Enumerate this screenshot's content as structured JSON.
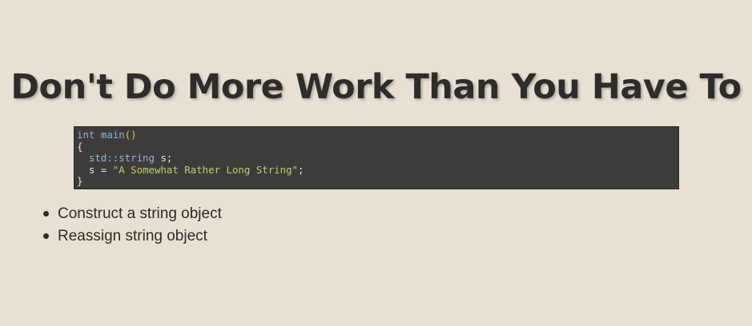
{
  "slide": {
    "title": "Don't Do More Work Than You Have To",
    "code": {
      "line1": {
        "kw": "int",
        "fn": "main",
        "paren": "()"
      },
      "line2": "{",
      "line3": {
        "indent": "  ",
        "ns": "std::string",
        "rest": " s;"
      },
      "line4": {
        "prefix": "  s = ",
        "str": "\"A Somewhat Rather Long String\"",
        "suffix": ";"
      },
      "line5": "}"
    },
    "bullets": [
      "Construct a string object",
      "Reassign string object"
    ]
  },
  "colors": {
    "background": "#e8e1d3",
    "code_background": "#3d3c3b",
    "keyword": "#8fb7d9",
    "string": "#b5d16a",
    "paren": "#e8c35a"
  }
}
